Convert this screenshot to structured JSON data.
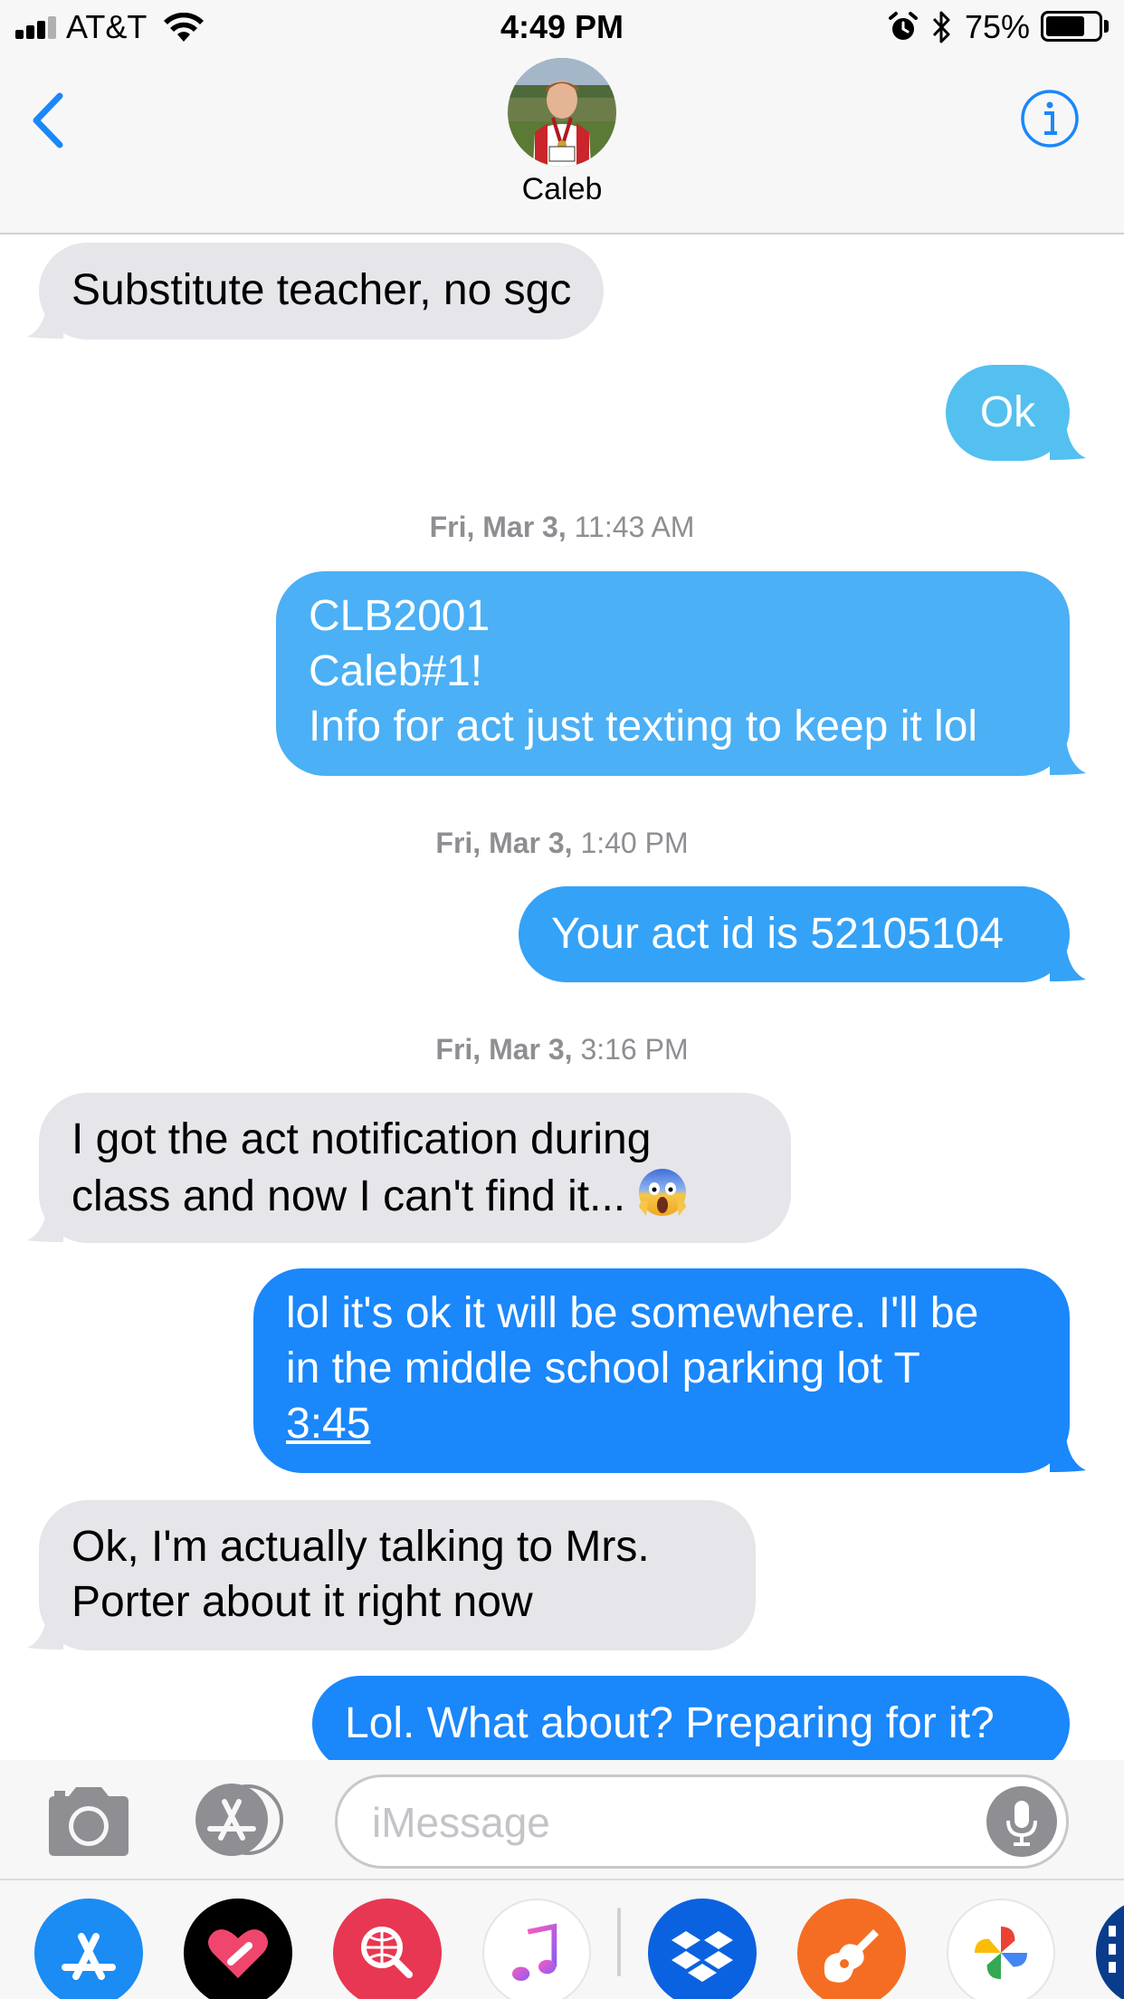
{
  "status_bar": {
    "carrier": "AT&T",
    "time": "4:49 PM",
    "battery_percent": "75%",
    "battery_level": 0.75,
    "signal_bars_filled": 3,
    "icons": [
      "signal-icon",
      "wifi-icon",
      "alarm-icon",
      "bluetooth-icon",
      "battery-icon"
    ]
  },
  "header": {
    "contact_name": "Caleb",
    "back_icon": "chevron-left-icon",
    "info_icon": "info-icon",
    "accent_color": "#1a87fb"
  },
  "messages": [
    {
      "direction": "received",
      "lines": [
        "Substitute teacher, no sgc"
      ]
    },
    {
      "direction": "sent",
      "lines": [
        "Ok"
      ]
    },
    {
      "direction": "sent",
      "lines": [
        "CLB2001",
        "Caleb#1!",
        "Info for act just texting to keep it lol"
      ]
    },
    {
      "direction": "sent",
      "lines": [
        "Your act id is 52105104"
      ]
    },
    {
      "direction": "received",
      "lines": [
        "I got the act notification during",
        "class and now I can't find it..."
      ]
    },
    {
      "direction": "sent",
      "lines": [
        "lol it's ok it will be somewhere. I'll be",
        "in the middle school parking lot T",
        "3:45"
      ]
    },
    {
      "direction": "received",
      "lines": [
        "Ok, I'm actually talking to Mrs.",
        "Porter about it right now"
      ]
    },
    {
      "direction": "sent",
      "lines": [
        "Lol. What about? Preparing for it?"
      ]
    }
  ],
  "timestamps": [
    {
      "day": "Fri, Mar 3,",
      "time": "11:43 AM"
    },
    {
      "day": "Fri, Mar 3,",
      "time": "1:40 PM"
    },
    {
      "day": "Fri, Mar 3,",
      "time": "3:16 PM"
    }
  ],
  "input_bar": {
    "placeholder": "iMessage",
    "value": "",
    "camera_icon": "camera-icon",
    "apps_icon": "app-store-icon",
    "mic_icon": "microphone-icon"
  },
  "app_drawer": {
    "apps": [
      "app-store-app",
      "digital-touch-app",
      "web-images-app",
      "music-app",
      "dropbox-app",
      "garageband-app",
      "google-photos-app",
      "partial-app"
    ]
  },
  "colors": {
    "received_bubble": "#e5e5ea",
    "sent_bubble_top": "#54c0f0",
    "sent_bubble_bottom": "#1a87fb",
    "timestamp_text": "#8e8e93"
  }
}
